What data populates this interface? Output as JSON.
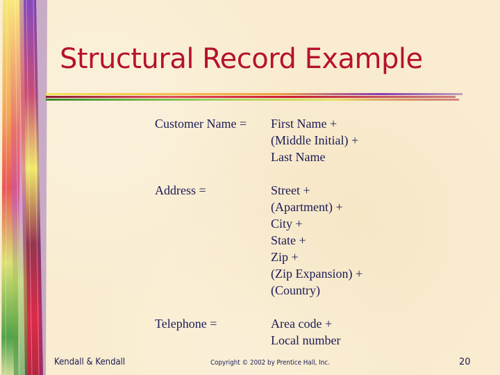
{
  "slide": {
    "title": "Structural Record Example",
    "entries": [
      {
        "term": "Customer Name =",
        "definition": [
          "First Name +",
          "(Middle Initial) +",
          "Last Name"
        ]
      },
      {
        "term": "Address =",
        "definition": [
          "Street +",
          "(Apartment) +",
          "City +",
          "State +",
          "Zip +",
          "(Zip Expansion) +",
          "(Country)"
        ]
      },
      {
        "term": "Telephone =",
        "definition": [
          "Area code +",
          "Local number"
        ]
      }
    ]
  },
  "footer": {
    "author": "Kendall & Kendall",
    "copyright": "Copyright © 2002 by Prentice Hall, Inc.",
    "page_number": "20"
  },
  "colors": {
    "background": "#f9ecd0",
    "title": "#b5122e",
    "body_text": "#1a1a55"
  }
}
